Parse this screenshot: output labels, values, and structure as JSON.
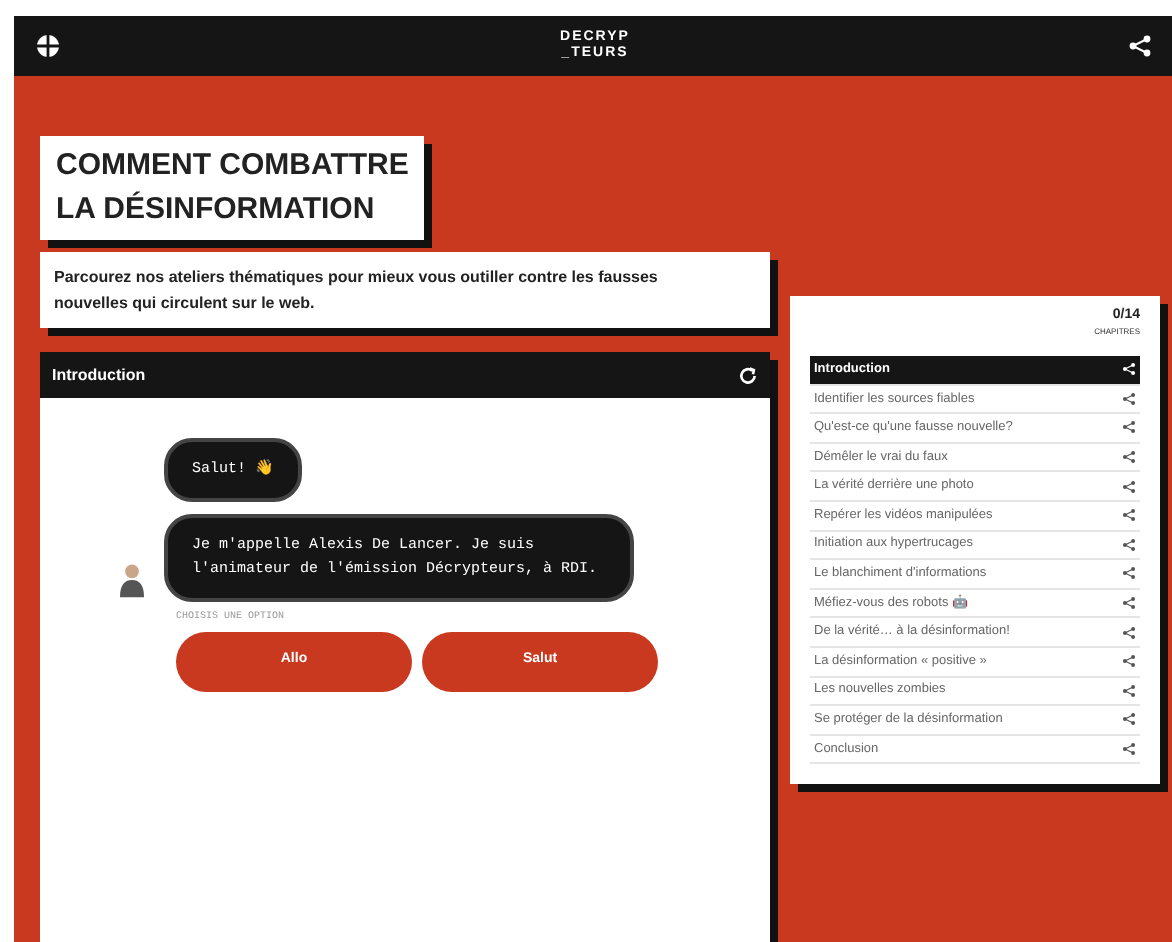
{
  "top_bar": {
    "logo_lines": [
      "DECRYP",
      "_TEURS"
    ]
  },
  "title_lines": [
    "COMMENT COMBATTRE",
    "LA DÉSINFORMATION"
  ],
  "description": "Parcourez nos ateliers thématiques pour mieux vous outiller contre les fausses nouvelles qui circulent sur le web.",
  "chat": {
    "title": "Introduction",
    "messages": [
      "Salut! 👋",
      "Je m'appelle Alexis De Lancer. Je suis l'animateur de l'émission Décrypteurs, à RDI."
    ],
    "prompt": "CHOISIS UNE OPTION",
    "options": [
      "Allo",
      "Salut"
    ]
  },
  "chapters": {
    "count": "0/14",
    "count_label": "CHAPITRES",
    "items": [
      {
        "label": "Introduction",
        "selected": true
      },
      {
        "label": "Identifier les sources fiables",
        "selected": false
      },
      {
        "label": "Qu'est-ce qu'une fausse nouvelle?",
        "selected": false
      },
      {
        "label": "Démêler le vrai du faux",
        "selected": false
      },
      {
        "label": "La vérité derrière une photo",
        "selected": false
      },
      {
        "label": "Repérer les vidéos manipulées",
        "selected": false
      },
      {
        "label": "Initiation aux hypertrucages",
        "selected": false
      },
      {
        "label": "Le blanchiment d'informations",
        "selected": false
      },
      {
        "label": "Méfiez-vous des robots 🤖",
        "selected": false
      },
      {
        "label": "De la vérité… à la désinformation!",
        "selected": false
      },
      {
        "label": "La désinformation « positive »",
        "selected": false
      },
      {
        "label": "Les nouvelles zombies",
        "selected": false
      },
      {
        "label": "Se protéger de la désinformation",
        "selected": false
      },
      {
        "label": "Conclusion",
        "selected": false
      }
    ]
  }
}
